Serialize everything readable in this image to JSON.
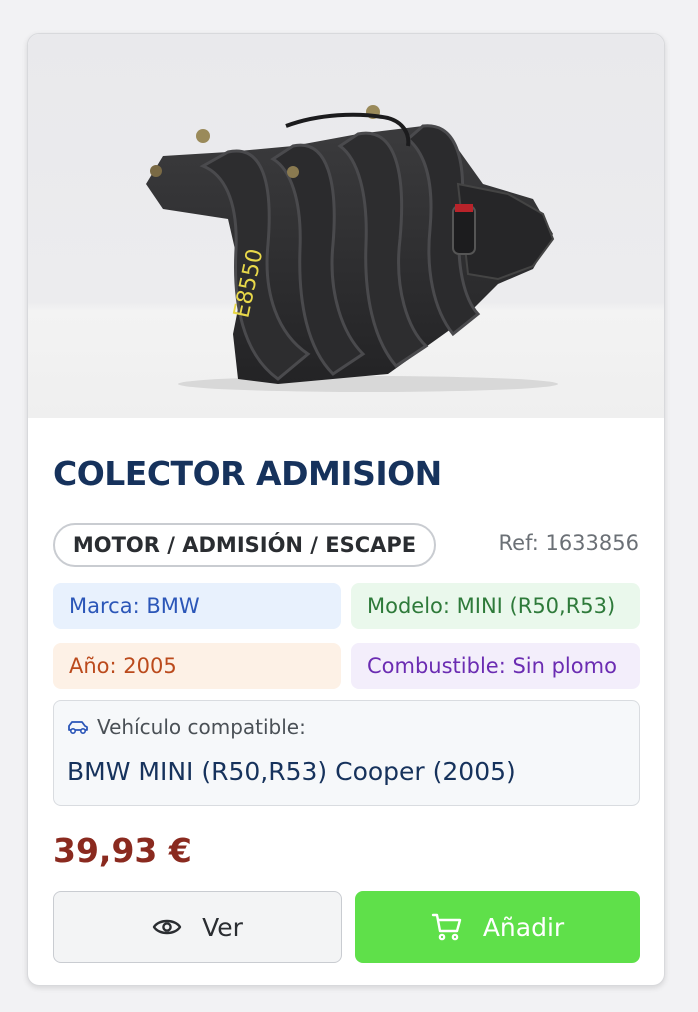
{
  "product": {
    "image_alt": "colector-admision-photo",
    "title": "COLECTOR ADMISION",
    "category": "MOTOR / ADMISIÓN / ESCAPE",
    "ref": "Ref: 1633856",
    "part_marking": "E8550"
  },
  "attributes": {
    "brand": "Marca: BMW",
    "model": "Modelo: MINI (R50,R53)",
    "year": "Año: 2005",
    "fuel": "Combustible: Sin plomo"
  },
  "compatibility": {
    "label": "Vehículo compatible:",
    "value": "BMW MINI (R50,R53) Cooper (2005)",
    "icon": "car-icon"
  },
  "price": "39,93 €",
  "actions": {
    "view_label": "Ver",
    "view_icon": "eye-icon",
    "add_label": "Añadir",
    "add_icon": "cart-icon"
  },
  "colors": {
    "title": "#16325c",
    "price": "#8a2a1f",
    "add_button": "#5fe04a"
  }
}
